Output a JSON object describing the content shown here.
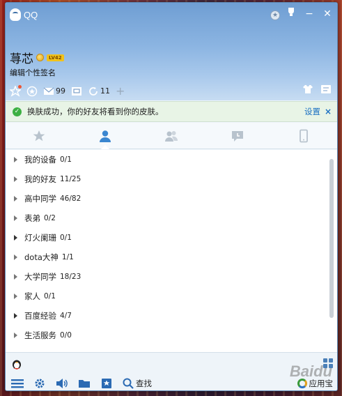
{
  "window": {
    "title": "QQ"
  },
  "profile": {
    "nickname": "荨芯",
    "level": "LV42",
    "signature": "编辑个性签名"
  },
  "toolbar": {
    "mail_count": "99",
    "qzone_count": "11"
  },
  "notice": {
    "text": "换肤成功，你的好友将看到你的皮肤。",
    "link": "设置",
    "close": "×"
  },
  "tabs": [
    {
      "name": "favorites",
      "icon": "star-icon"
    },
    {
      "name": "contacts",
      "icon": "contacts-icon",
      "active": true
    },
    {
      "name": "groups",
      "icon": "group-icon"
    },
    {
      "name": "recent",
      "icon": "chat-icon"
    },
    {
      "name": "phone",
      "icon": "phone-icon"
    }
  ],
  "groups": [
    {
      "name": "我的设备",
      "count": "0/1"
    },
    {
      "name": "我的好友",
      "count": "11/25"
    },
    {
      "name": "高中同学",
      "count": "46/82"
    },
    {
      "name": "表弟",
      "count": "0/2"
    },
    {
      "name": "灯火阑珊",
      "count": "0/1"
    },
    {
      "name": "dota大神",
      "count": "1/1"
    },
    {
      "name": "大学同学",
      "count": "18/23"
    },
    {
      "name": "家人",
      "count": "0/1"
    },
    {
      "name": "百度经验",
      "count": "4/7"
    },
    {
      "name": "生活服务",
      "count": "0/0"
    }
  ],
  "bottom": {
    "search_label": "查找",
    "app_store_label": "应用宝"
  },
  "watermark": "Baidu"
}
